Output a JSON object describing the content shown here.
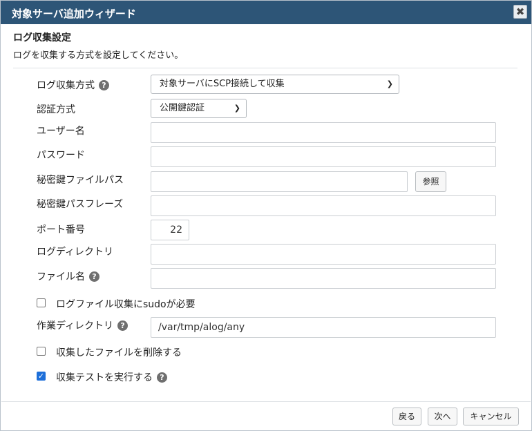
{
  "window": {
    "title": "対象サーバ追加ウィザード",
    "close_glyph": "✖"
  },
  "section": {
    "title": "ログ収集設定",
    "description": "ログを収集する方式を設定してください。"
  },
  "form": {
    "collection_method": {
      "label": "ログ収集方式",
      "value": "対象サーバにSCP接続して収集",
      "help_icon": "question-icon"
    },
    "auth_method": {
      "label": "認証方式",
      "value": "公開鍵認証"
    },
    "username": {
      "label": "ユーザー名",
      "value": ""
    },
    "password": {
      "label": "パスワード",
      "value": ""
    },
    "private_key_path": {
      "label": "秘密鍵ファイルパス",
      "value": "",
      "browse_label": "参照"
    },
    "passphrase": {
      "label": "秘密鍵パスフレーズ",
      "value": ""
    },
    "port": {
      "label": "ポート番号",
      "value": "22"
    },
    "log_directory": {
      "label": "ログディレクトリ",
      "value": ""
    },
    "file_name": {
      "label": "ファイル名",
      "value": "",
      "help_icon": "question-icon"
    },
    "sudo_required": {
      "label": "ログファイル収集にsudoが必要",
      "checked": false
    },
    "work_directory": {
      "label": "作業ディレクトリ",
      "value": "/var/tmp/alog/any",
      "help_icon": "question-icon"
    },
    "delete_collected": {
      "label": "収集したファイルを削除する",
      "checked": false
    },
    "run_test": {
      "label": "収集テストを実行する",
      "checked": true,
      "help_icon": "question-icon"
    }
  },
  "footer": {
    "back_label": "戻る",
    "next_label": "次へ",
    "cancel_label": "キャンセル"
  },
  "colors": {
    "titlebar": "#2d5577",
    "checkbox_checked": "#1e6fd9"
  }
}
